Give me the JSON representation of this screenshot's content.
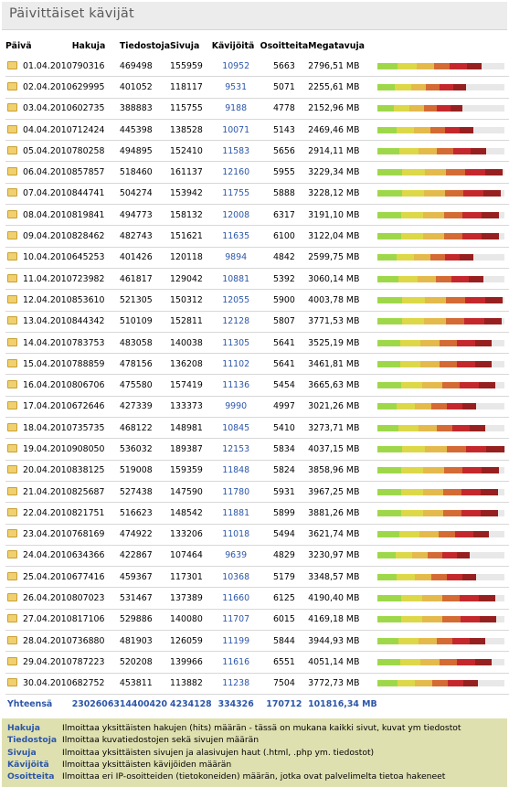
{
  "title": "Päivittäiset kävijät",
  "headers": {
    "date": "Päivä",
    "hakuja": "Hakuja",
    "tiedostoja": "Tiedostoja",
    "sivuja": "Sivuja",
    "kavijoita": "Kävijöitä",
    "osoitteita": "Osoitteita",
    "megatavuja": "Megatavuja"
  },
  "bar_colors": [
    "#9ed84a",
    "#dcd848",
    "#e4ba4c",
    "#d46a34",
    "#c4282c",
    "#962020"
  ],
  "folder_icon": "folder-icon",
  "rows": [
    {
      "date": "01.04.2010",
      "hakuja": "790316",
      "tiedostoja": "469498",
      "sivuja": "155959",
      "kavijoita": "10952",
      "osoitteita": "5663",
      "megatavuja": "2796,51 MB",
      "bar_fraction": 0.82
    },
    {
      "date": "02.04.2010",
      "hakuja": "629995",
      "tiedostoja": "401052",
      "sivuja": "118117",
      "kavijoita": "9531",
      "osoitteita": "5071",
      "megatavuja": "2255,61 MB",
      "bar_fraction": 0.7
    },
    {
      "date": "03.04.2010",
      "hakuja": "602735",
      "tiedostoja": "388883",
      "sivuja": "115755",
      "kavijoita": "9188",
      "osoitteita": "4778",
      "megatavuja": "2152,96 MB",
      "bar_fraction": 0.67
    },
    {
      "date": "04.04.2010",
      "hakuja": "712424",
      "tiedostoja": "445398",
      "sivuja": "138528",
      "kavijoita": "10071",
      "osoitteita": "5143",
      "megatavuja": "2469,46 MB",
      "bar_fraction": 0.76
    },
    {
      "date": "05.04.2010",
      "hakuja": "780258",
      "tiedostoja": "494895",
      "sivuja": "152410",
      "kavijoita": "11583",
      "osoitteita": "5656",
      "megatavuja": "2914,11 MB",
      "bar_fraction": 0.86
    },
    {
      "date": "06.04.2010",
      "hakuja": "857857",
      "tiedostoja": "518460",
      "sivuja": "161137",
      "kavijoita": "12160",
      "osoitteita": "5955",
      "megatavuja": "3229,34 MB",
      "bar_fraction": 0.99
    },
    {
      "date": "07.04.2010",
      "hakuja": "844741",
      "tiedostoja": "504274",
      "sivuja": "153942",
      "kavijoita": "11755",
      "osoitteita": "5888",
      "megatavuja": "3228,12 MB",
      "bar_fraction": 0.97
    },
    {
      "date": "08.04.2010",
      "hakuja": "819841",
      "tiedostoja": "494773",
      "sivuja": "158132",
      "kavijoita": "12008",
      "osoitteita": "6317",
      "megatavuja": "3191,10 MB",
      "bar_fraction": 0.96
    },
    {
      "date": "09.04.2010",
      "hakuja": "828462",
      "tiedostoja": "482743",
      "sivuja": "151621",
      "kavijoita": "11635",
      "osoitteita": "6100",
      "megatavuja": "3122,04 MB",
      "bar_fraction": 0.96
    },
    {
      "date": "10.04.2010",
      "hakuja": "645253",
      "tiedostoja": "401426",
      "sivuja": "120118",
      "kavijoita": "9894",
      "osoitteita": "4842",
      "megatavuja": "2599,75 MB",
      "bar_fraction": 0.76
    },
    {
      "date": "11.04.2010",
      "hakuja": "723982",
      "tiedostoja": "461817",
      "sivuja": "129042",
      "kavijoita": "10881",
      "osoitteita": "5392",
      "megatavuja": "3060,14 MB",
      "bar_fraction": 0.84
    },
    {
      "date": "12.04.2010",
      "hakuja": "853610",
      "tiedostoja": "521305",
      "sivuja": "150312",
      "kavijoita": "12055",
      "osoitteita": "5900",
      "megatavuja": "4003,78 MB",
      "bar_fraction": 0.99
    },
    {
      "date": "13.04.2010",
      "hakuja": "844342",
      "tiedostoja": "510109",
      "sivuja": "152811",
      "kavijoita": "12128",
      "osoitteita": "5807",
      "megatavuja": "3771,53 MB",
      "bar_fraction": 0.98
    },
    {
      "date": "14.04.2010",
      "hakuja": "783753",
      "tiedostoja": "483058",
      "sivuja": "140038",
      "kavijoita": "11305",
      "osoitteita": "5641",
      "megatavuja": "3525,19 MB",
      "bar_fraction": 0.9
    },
    {
      "date": "15.04.2010",
      "hakuja": "788859",
      "tiedostoja": "478156",
      "sivuja": "136208",
      "kavijoita": "11102",
      "osoitteita": "5641",
      "megatavuja": "3461,81 MB",
      "bar_fraction": 0.9
    },
    {
      "date": "16.04.2010",
      "hakuja": "806706",
      "tiedostoja": "475580",
      "sivuja": "157419",
      "kavijoita": "11136",
      "osoitteita": "5454",
      "megatavuja": "3665,63 MB",
      "bar_fraction": 0.93
    },
    {
      "date": "17.04.2010",
      "hakuja": "672646",
      "tiedostoja": "427339",
      "sivuja": "133373",
      "kavijoita": "9990",
      "osoitteita": "4997",
      "megatavuja": "3021,26 MB",
      "bar_fraction": 0.78
    },
    {
      "date": "18.04.2010",
      "hakuja": "735735",
      "tiedostoja": "468122",
      "sivuja": "148981",
      "kavijoita": "10845",
      "osoitteita": "5410",
      "megatavuja": "3273,71 MB",
      "bar_fraction": 0.85
    },
    {
      "date": "19.04.2010",
      "hakuja": "908050",
      "tiedostoja": "536032",
      "sivuja": "189387",
      "kavijoita": "12153",
      "osoitteita": "5834",
      "megatavuja": "4037,15 MB",
      "bar_fraction": 1.0
    },
    {
      "date": "20.04.2010",
      "hakuja": "838125",
      "tiedostoja": "519008",
      "sivuja": "159359",
      "kavijoita": "11848",
      "osoitteita": "5824",
      "megatavuja": "3858,96 MB",
      "bar_fraction": 0.96
    },
    {
      "date": "21.04.2010",
      "hakuja": "825687",
      "tiedostoja": "527438",
      "sivuja": "147590",
      "kavijoita": "11780",
      "osoitteita": "5931",
      "megatavuja": "3967,25 MB",
      "bar_fraction": 0.95
    },
    {
      "date": "22.04.2010",
      "hakuja": "821751",
      "tiedostoja": "516623",
      "sivuja": "148542",
      "kavijoita": "11881",
      "osoitteita": "5899",
      "megatavuja": "3881,26 MB",
      "bar_fraction": 0.95
    },
    {
      "date": "23.04.2010",
      "hakuja": "768169",
      "tiedostoja": "474922",
      "sivuja": "133206",
      "kavijoita": "11018",
      "osoitteita": "5494",
      "megatavuja": "3621,74 MB",
      "bar_fraction": 0.88
    },
    {
      "date": "24.04.2010",
      "hakuja": "634366",
      "tiedostoja": "422867",
      "sivuja": "107464",
      "kavijoita": "9639",
      "osoitteita": "4829",
      "megatavuja": "3230,97 MB",
      "bar_fraction": 0.73
    },
    {
      "date": "25.04.2010",
      "hakuja": "677416",
      "tiedostoja": "459367",
      "sivuja": "117301",
      "kavijoita": "10368",
      "osoitteita": "5179",
      "megatavuja": "3348,57 MB",
      "bar_fraction": 0.78
    },
    {
      "date": "26.04.2010",
      "hakuja": "807023",
      "tiedostoja": "531467",
      "sivuja": "137389",
      "kavijoita": "11660",
      "osoitteita": "6125",
      "megatavuja": "4190,40 MB",
      "bar_fraction": 0.93
    },
    {
      "date": "27.04.2010",
      "hakuja": "817106",
      "tiedostoja": "529886",
      "sivuja": "140080",
      "kavijoita": "11707",
      "osoitteita": "6015",
      "megatavuja": "4169,18 MB",
      "bar_fraction": 0.94
    },
    {
      "date": "28.04.2010",
      "hakuja": "736880",
      "tiedostoja": "481903",
      "sivuja": "126059",
      "kavijoita": "11199",
      "osoitteita": "5844",
      "megatavuja": "3944,93 MB",
      "bar_fraction": 0.85
    },
    {
      "date": "29.04.2010",
      "hakuja": "787223",
      "tiedostoja": "520208",
      "sivuja": "139966",
      "kavijoita": "11616",
      "osoitteita": "6551",
      "megatavuja": "4051,14 MB",
      "bar_fraction": 0.9
    },
    {
      "date": "30.04.2010",
      "hakuja": "682752",
      "tiedostoja": "453811",
      "sivuja": "113882",
      "kavijoita": "11238",
      "osoitteita": "7504",
      "megatavuja": "3772,73 MB",
      "bar_fraction": 0.79
    }
  ],
  "totals": {
    "label": "Yhteensä",
    "hakuja": "23026063",
    "tiedostoja": "14400420",
    "sivuja": "4234128",
    "kavijoita": "334326",
    "osoitteita": "170712",
    "megatavuja": "101816,34 MB"
  },
  "legend": [
    {
      "term": "Hakuja",
      "desc": "Ilmoittaa yksittäisten hakujen (hits) määrän - tässä on mukana kaikki sivut, kuvat ym tiedostot"
    },
    {
      "term": "Tiedostoja",
      "desc": "Ilmoittaa kuvatiedostojen sekä sivujen määrän"
    },
    {
      "term": "Sivuja",
      "desc": "Ilmoittaa yksittäisten sivujen ja alasivujen haut (.html, .php ym. tiedostot)"
    },
    {
      "term": "Kävijöitä",
      "desc": "Ilmoittaa yksittäisten kävijöiden määrän"
    },
    {
      "term": "Osoitteita",
      "desc": "Ilmoittaa eri IP-osoitteiden (tietokoneiden) määrän, jotka ovat palvelimelta tietoa hakeneet"
    }
  ]
}
